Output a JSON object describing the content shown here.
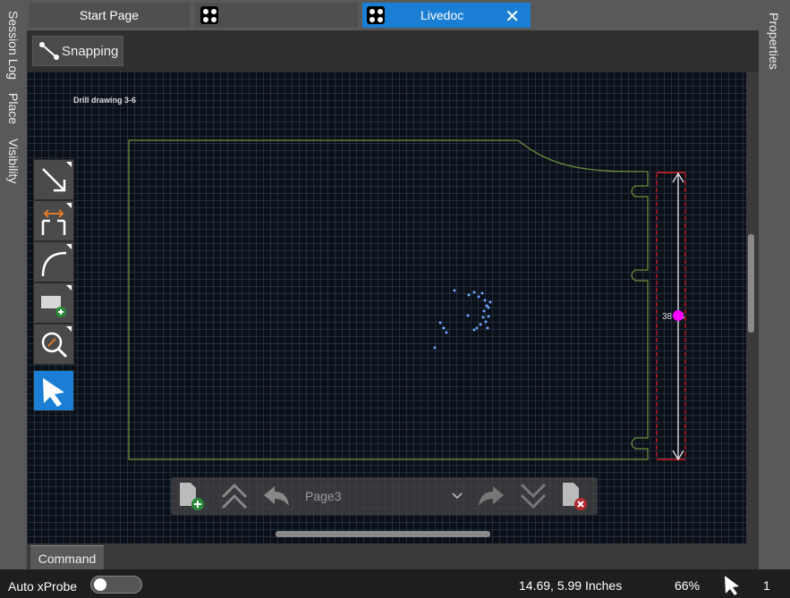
{
  "left_tabs": [
    "Session Log",
    "Place",
    "Visibility"
  ],
  "right_tabs": [
    "Properties"
  ],
  "doc_tabs": [
    {
      "label": "Start Page"
    },
    {
      "label": ""
    },
    {
      "label": "Livedoc",
      "active": true
    }
  ],
  "toolbar": {
    "snapping_label": "Snapping"
  },
  "drawing": {
    "title": "Drill drawing 3-6",
    "dimension_label": "38 95",
    "board_outline_color": "#6a8f3a",
    "dimension_color": "#d21e28",
    "marker_color": "#ff00ff",
    "drill_hit_color": "#6aa9ff"
  },
  "tools": [
    {
      "icon": "arrow-diagonal-icon"
    },
    {
      "icon": "dimension-icon"
    },
    {
      "icon": "arc-icon"
    },
    {
      "icon": "add-view-icon"
    },
    {
      "icon": "zoom-icon"
    },
    {
      "icon": "select-pointer-icon",
      "active": true
    }
  ],
  "page_nav": {
    "page": "Page3"
  },
  "command_tab": "Command",
  "status": {
    "auto_xprobe_label": "Auto xProbe",
    "auto_xprobe_on": false,
    "coordinates": "14.69, 5.99 Inches",
    "zoom": "66%",
    "selection_count": "1"
  },
  "colors": {
    "accent": "#1a7fd4",
    "panel": "#595959",
    "canvas": "#0b0f18"
  }
}
